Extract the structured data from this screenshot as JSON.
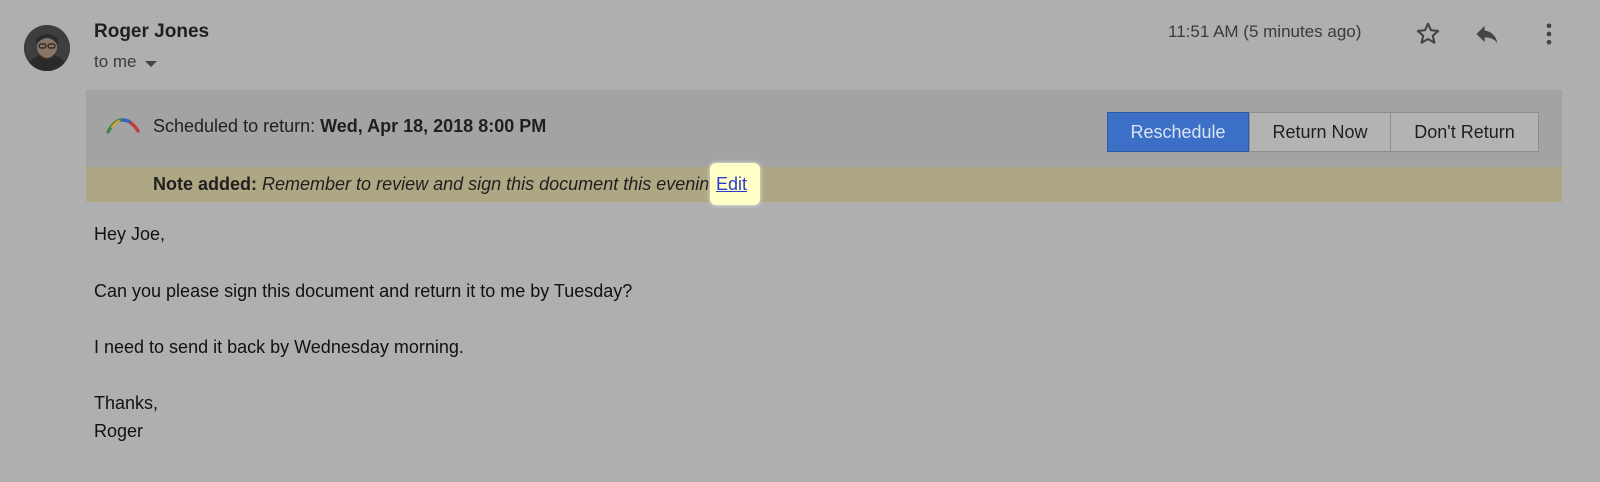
{
  "header": {
    "sender_name": "Roger Jones",
    "recipient": "to me",
    "timestamp": "11:51 AM (5 minutes ago)"
  },
  "banner": {
    "prefix": "Scheduled to return:",
    "datetime": "Wed, Apr 18, 2018 8:00 PM",
    "buttons": {
      "reschedule": "Reschedule",
      "return_now": "Return Now",
      "dont_return": "Don't Return"
    }
  },
  "note": {
    "label": "Note added:",
    "text": "Remember to review and sign this document this evening",
    "edit": "Edit"
  },
  "body": {
    "lines": [
      "Hey Joe,",
      "Can you please sign this document and return it to me by Tuesday?",
      "I need to send it back by Wednesday morning.",
      "Thanks,",
      "Roger"
    ]
  },
  "colors": {
    "background": "#afafaf",
    "primary_button": "#3c6fc6",
    "note_bar": "#aea784",
    "edit_highlight": "#ffffc6",
    "link": "#2c3bd3"
  }
}
